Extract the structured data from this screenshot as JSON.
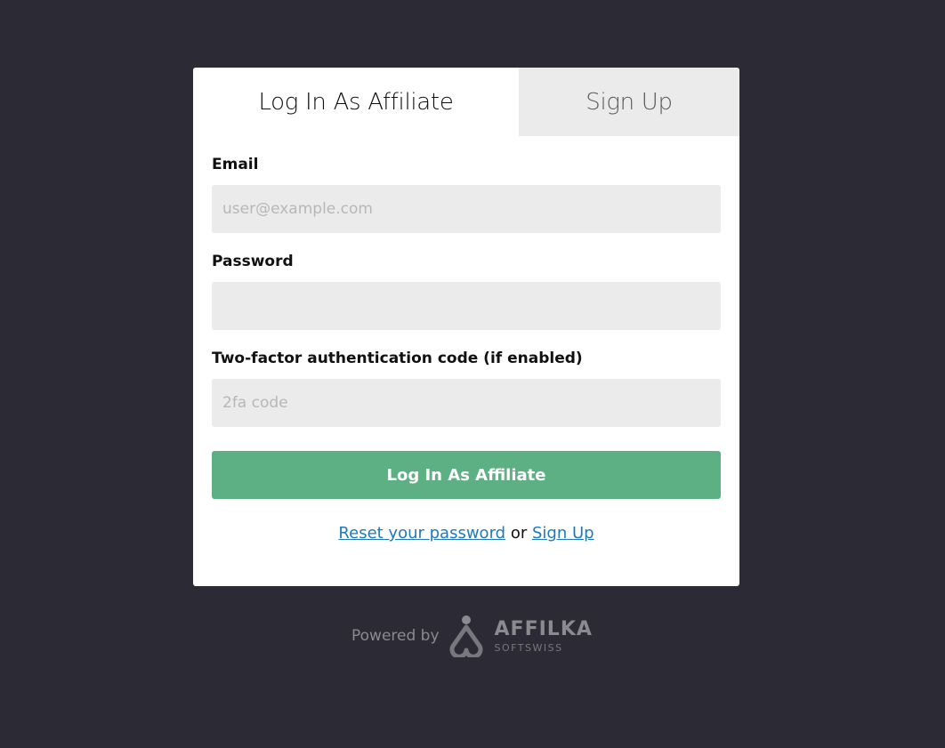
{
  "tabs": {
    "login_label": "Log In As Affiliate",
    "signup_label": "Sign Up"
  },
  "form": {
    "email_label": "Email",
    "email_placeholder": "user@example.com",
    "email_value": "",
    "password_label": "Password",
    "password_value": "",
    "twofa_label": "Two-factor authentication code (if enabled)",
    "twofa_placeholder": "2fa code",
    "twofa_value": "",
    "submit_label": "Log In As Affiliate"
  },
  "links": {
    "reset_label": "Reset your password",
    "separator": "or",
    "signup_label": "Sign Up"
  },
  "footer": {
    "powered_by": "Powered by",
    "brand_name": "AFFILKA",
    "brand_sub": "SOFTSWISS"
  },
  "colors": {
    "background": "#2c2b35",
    "accent_button": "#5db083",
    "link": "#1f7ab8",
    "input_bg": "#ebebeb"
  }
}
